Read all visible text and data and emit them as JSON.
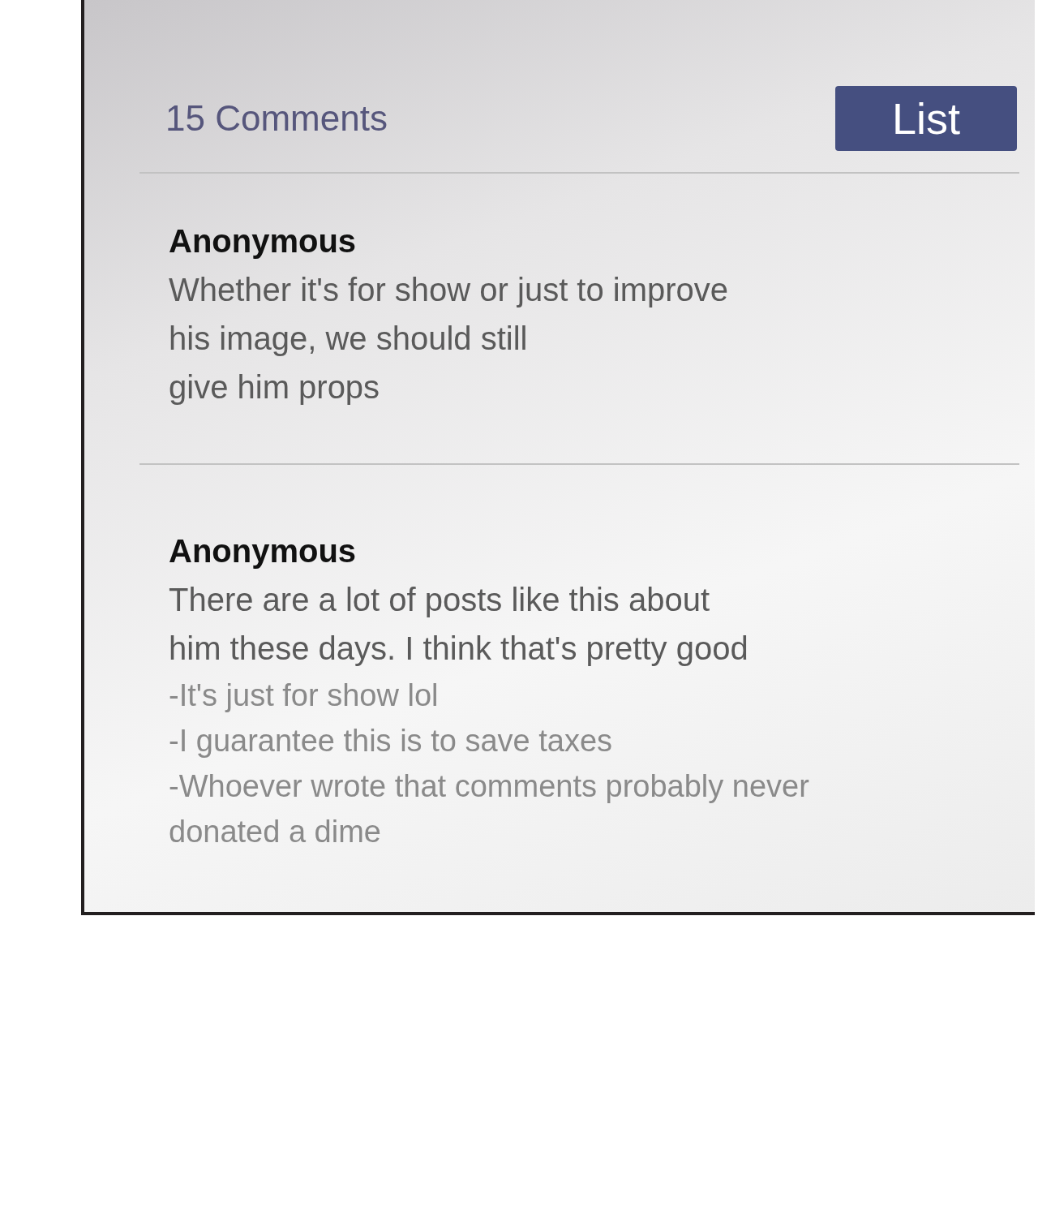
{
  "header": {
    "title": "15 Comments",
    "button": "List"
  },
  "comments": [
    {
      "author": "Anonymous",
      "body_lines": [
        "Whether it's for show or just to improve",
        "his image, we should still",
        "give him props"
      ]
    },
    {
      "author": "Anonymous",
      "body_lines": [
        "There are a lot of posts like this about",
        "him these days. I think that's pretty good"
      ],
      "replies": [
        {
          "lines": [
            "-It's just for show lol"
          ]
        },
        {
          "lines": [
            "-I guarantee this is to save taxes"
          ]
        },
        {
          "lines": [
            "-Whoever wrote that comments probably never",
            "donated a dime"
          ]
        }
      ]
    }
  ]
}
